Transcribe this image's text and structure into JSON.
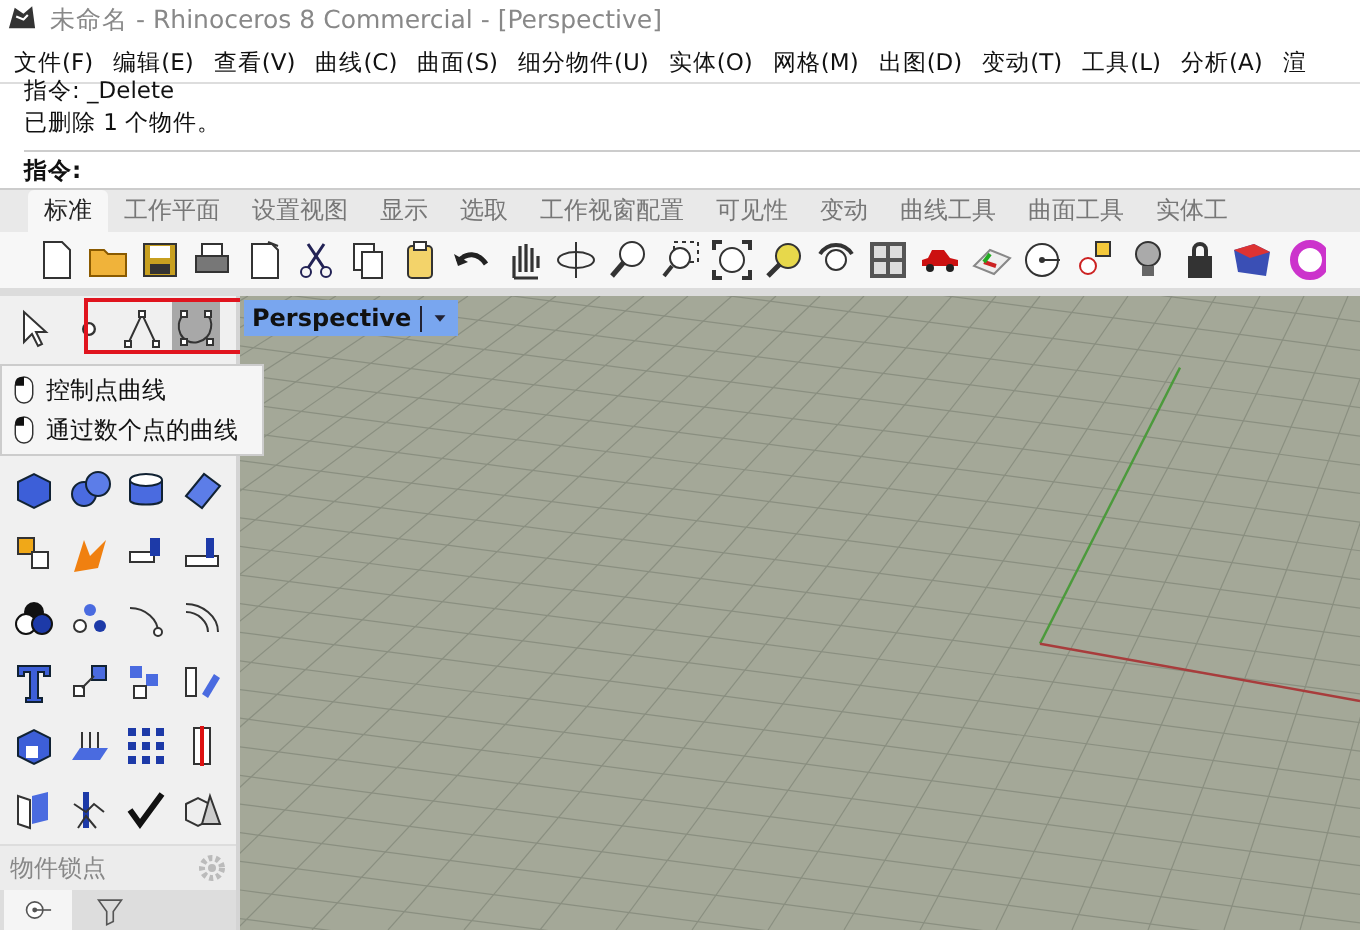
{
  "window": {
    "title": "未命名 - Rhinoceros 8 Commercial - [Perspective]"
  },
  "menu": [
    "文件(F)",
    "编辑(E)",
    "查看(V)",
    "曲线(C)",
    "曲面(S)",
    "细分物件(U)",
    "实体(O)",
    "网格(M)",
    "出图(D)",
    "变动(T)",
    "工具(L)",
    "分析(A)",
    "渲"
  ],
  "command_history": [
    "指令: _Delete",
    "已删除 1 个物件。"
  ],
  "command_prompt": {
    "label": "指令:"
  },
  "toolbar_tabs": [
    {
      "label": "标准",
      "selected": true
    },
    {
      "label": "工作平面",
      "selected": false
    },
    {
      "label": "设置视图",
      "selected": false
    },
    {
      "label": "显示",
      "selected": false
    },
    {
      "label": "选取",
      "selected": false
    },
    {
      "label": "工作视窗配置",
      "selected": false
    },
    {
      "label": "可见性",
      "selected": false
    },
    {
      "label": "变动",
      "selected": false
    },
    {
      "label": "曲线工具",
      "selected": false
    },
    {
      "label": "曲面工具",
      "selected": false
    },
    {
      "label": "实体工",
      "selected": false
    }
  ],
  "curve_tools": [
    {
      "selected": false
    },
    {
      "selected": false
    },
    {
      "selected": false
    },
    {
      "selected": true
    }
  ],
  "popup_menu": [
    {
      "label": "控制点曲线"
    },
    {
      "label": "通过数个点的曲线"
    }
  ],
  "viewport": {
    "title": "Perspective"
  },
  "osnap_panel": {
    "title": "物件锁点",
    "tabs": [
      {
        "selected": true
      },
      {
        "selected": false
      }
    ]
  }
}
